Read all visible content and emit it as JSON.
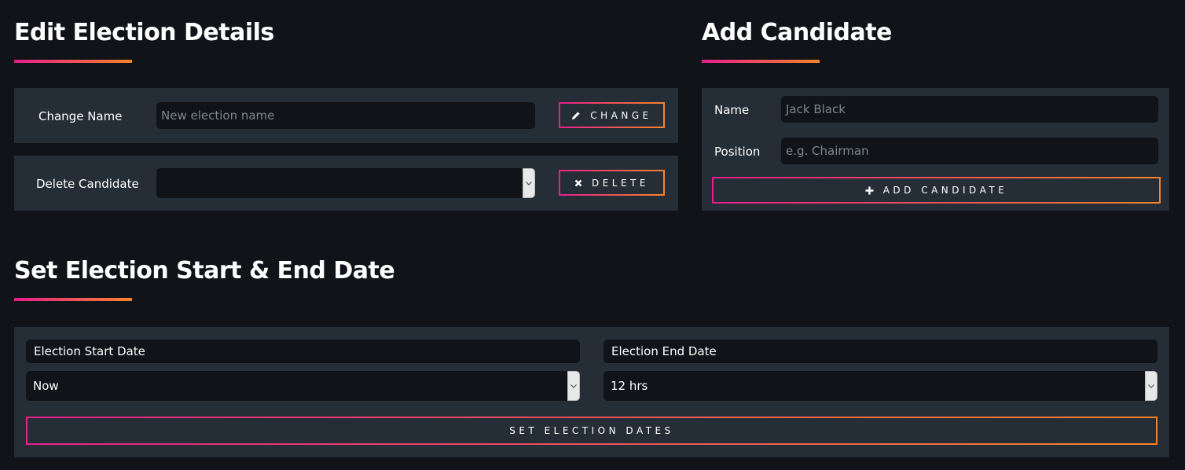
{
  "edit_section": {
    "title": "Edit Election Details",
    "change_name": {
      "label": "Change Name",
      "placeholder": "New election name",
      "button_label": "CHANGE",
      "button_icon": "pencil-icon"
    },
    "delete_candidate": {
      "label": "Delete Candidate",
      "selected": "",
      "button_label": "DELETE",
      "button_icon": "close-icon"
    }
  },
  "add_section": {
    "title": "Add Candidate",
    "name": {
      "label": "Name",
      "placeholder": "Jack Black"
    },
    "position": {
      "label": "Position",
      "placeholder": "e.g. Chairman"
    },
    "button_label": "ADD CANDIDATE",
    "button_icon": "plus-icon"
  },
  "dates_section": {
    "title": "Set Election Start & End Date",
    "start": {
      "label": "Election Start Date",
      "selected": "Now"
    },
    "end": {
      "label": "Election End Date",
      "selected": "12 hrs"
    },
    "button_label": "SET ELECTION DATES"
  },
  "colors": {
    "background": "#101418",
    "panel": "#252e36",
    "accent_start": "#e91e8c",
    "accent_end": "#f7842a"
  }
}
